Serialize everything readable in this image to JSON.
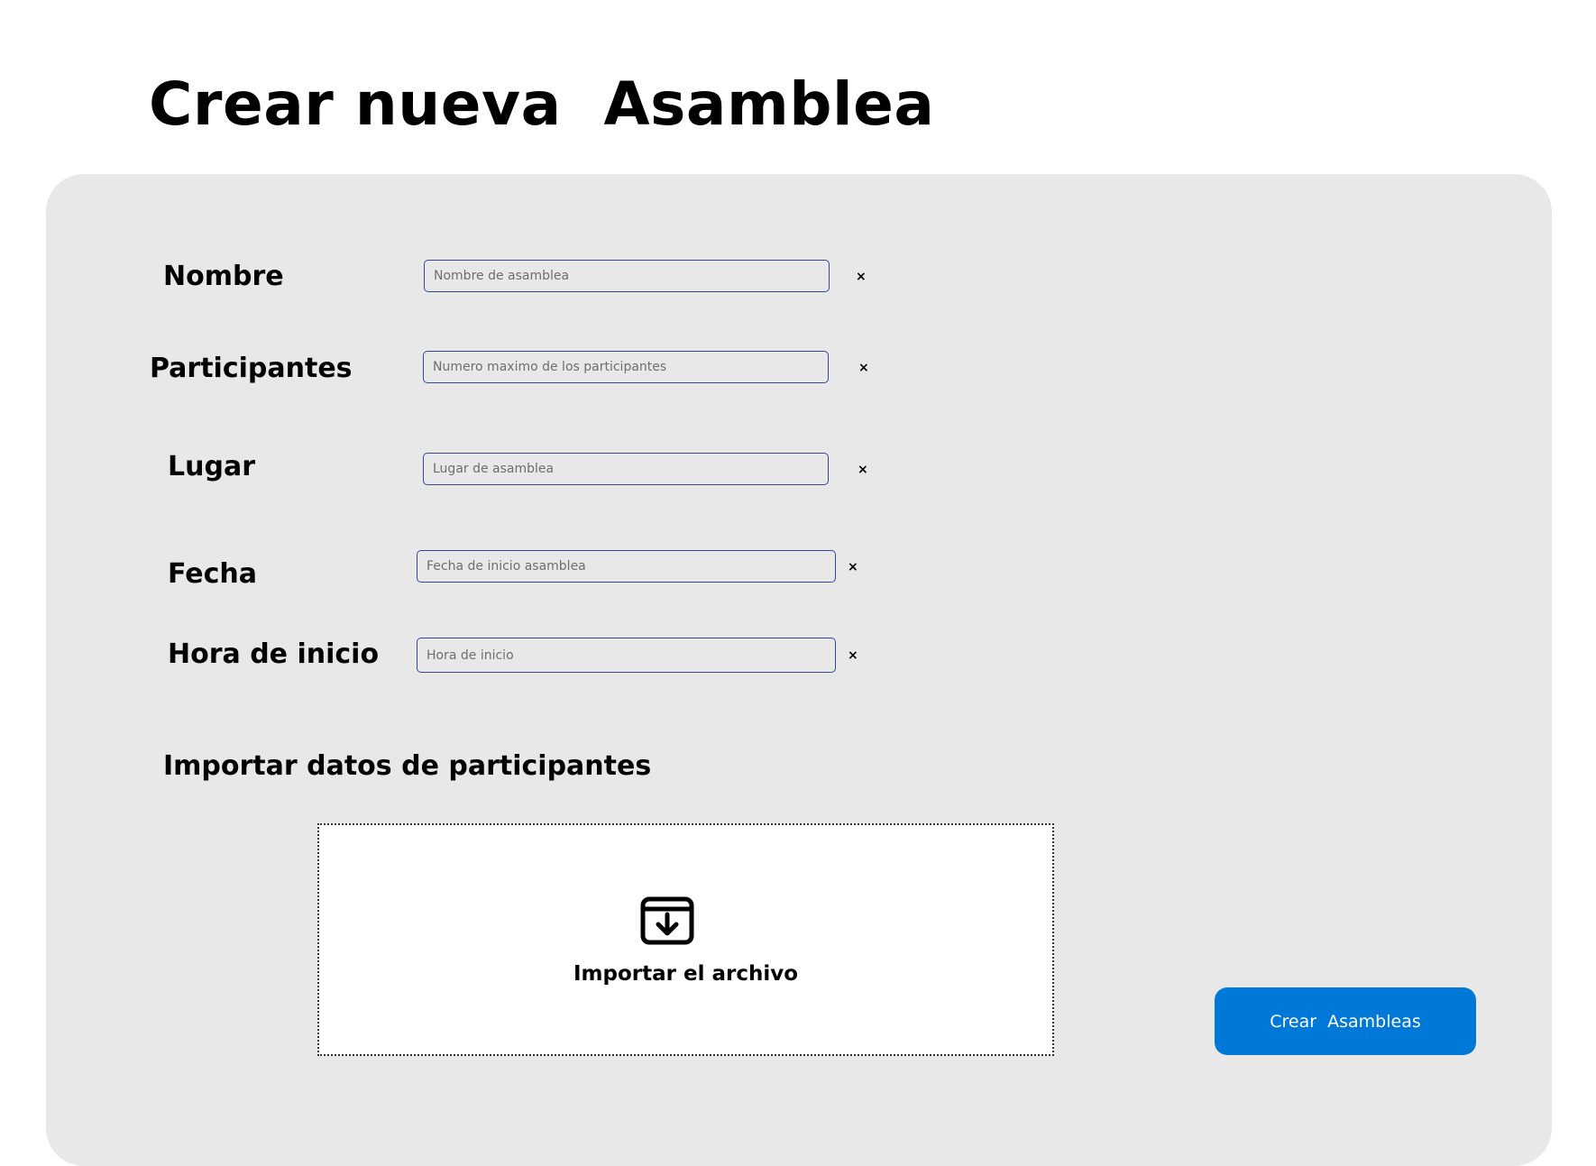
{
  "page": {
    "title": "Crear nueva  Asamblea"
  },
  "form": {
    "fields": [
      {
        "label": "Nombre",
        "placeholder": "Nombre de asamblea",
        "value": "",
        "clear_symbol": "×"
      },
      {
        "label": "Participantes",
        "placeholder": "Numero maximo de los participantes",
        "value": "",
        "clear_symbol": "×"
      },
      {
        "label": "Lugar",
        "placeholder": "Lugar de asamblea",
        "value": "",
        "clear_symbol": "×"
      },
      {
        "label": "Fecha",
        "placeholder": "Fecha de inicio asamblea",
        "value": "",
        "clear_symbol": "×"
      },
      {
        "label": "Hora de inicio",
        "placeholder": "Hora de inicio",
        "value": "",
        "clear_symbol": "×"
      }
    ],
    "field_border_color": "#3347a0"
  },
  "import": {
    "section_title": "Importar datos de participantes",
    "dropzone_label": "Importar el archivo",
    "icon": "archive-download-icon"
  },
  "actions": {
    "create_label": "Crear  Asambleas",
    "create_color": "#0078d7"
  },
  "colors": {
    "panel": "#e8e8e8",
    "background": "#ffffff"
  }
}
